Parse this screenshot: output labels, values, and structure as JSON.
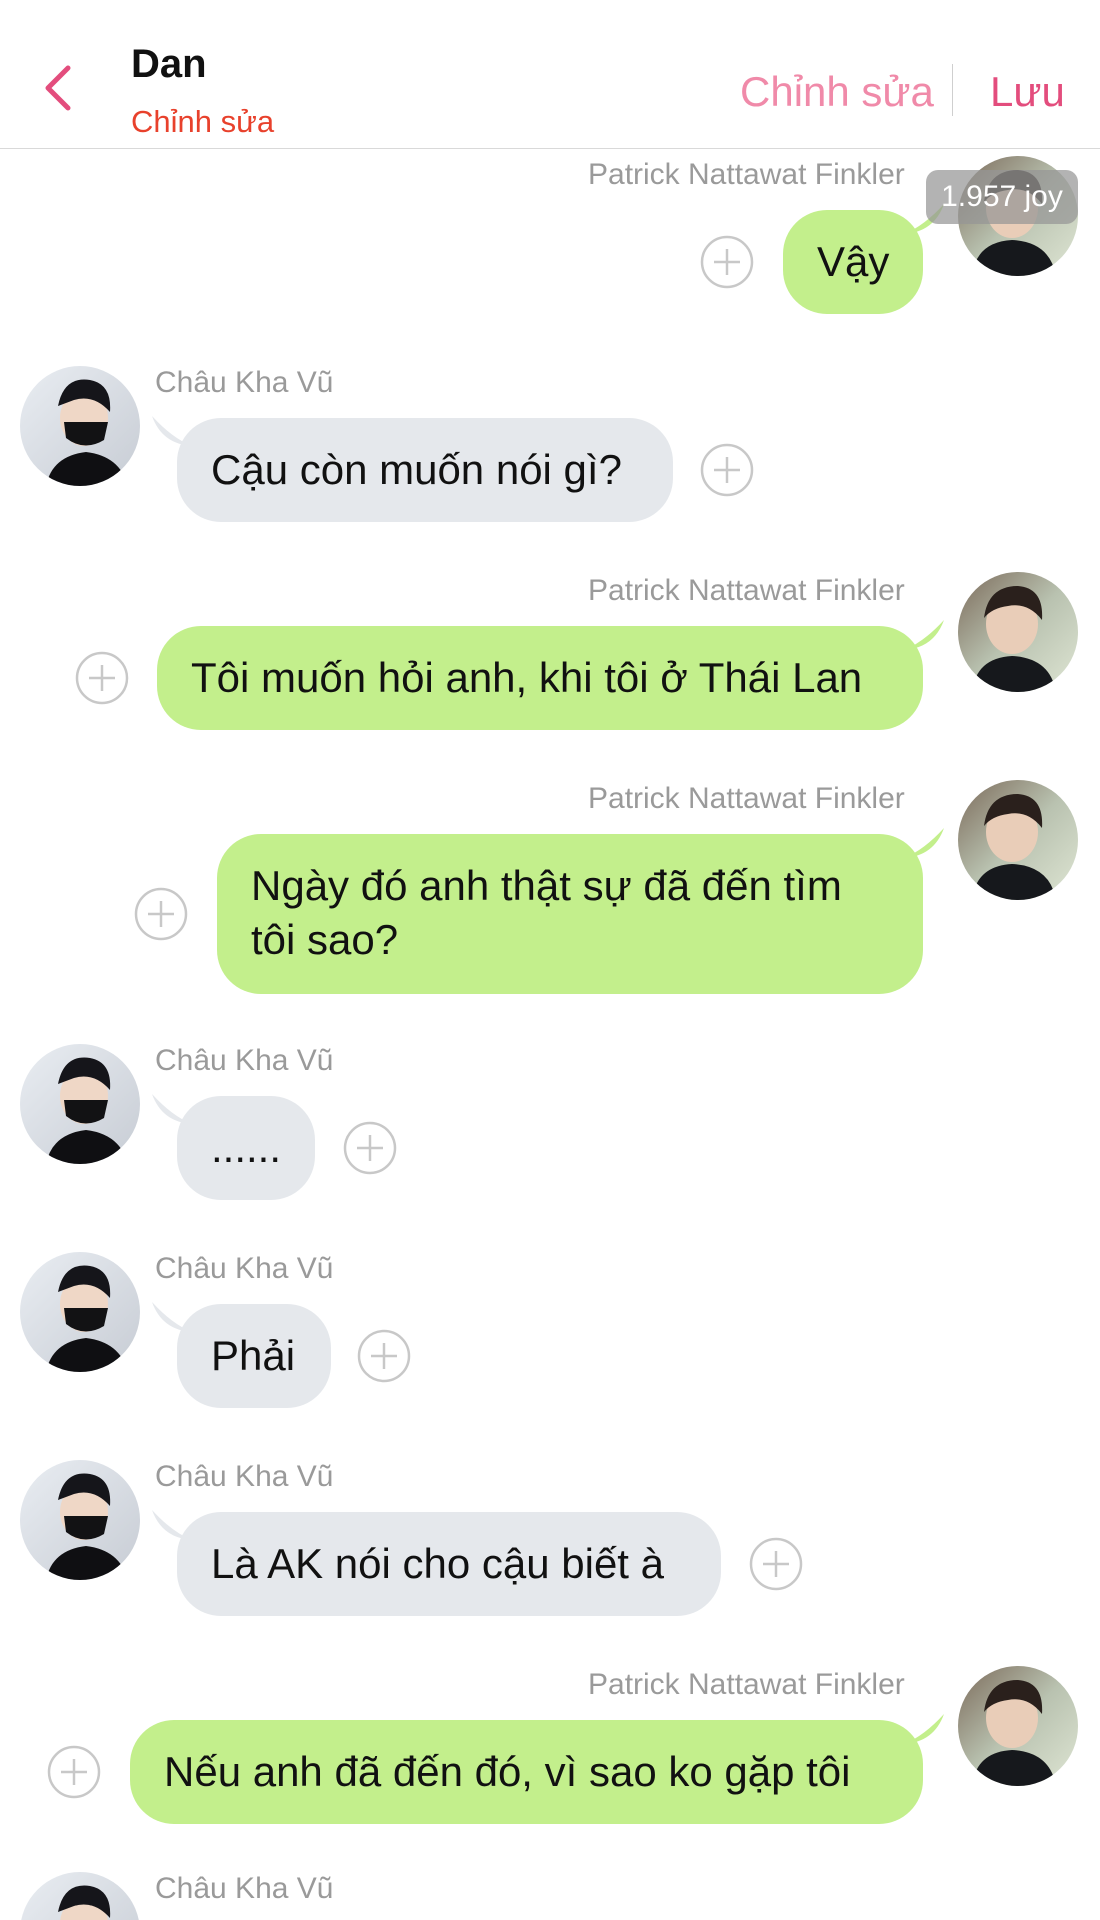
{
  "header": {
    "title": "Dan",
    "subtitle": "Chỉnh sửa",
    "edit_label": "Chỉnh sửa",
    "save_label": "Lưu"
  },
  "joy_badge": "1.957 joy",
  "messages": [
    {
      "side": "right",
      "sender": "Patrick Nattawat Finkler",
      "text": "Vậy"
    },
    {
      "side": "left",
      "sender": "Châu Kha Vũ",
      "text": "Cậu còn muốn nói gì?"
    },
    {
      "side": "right",
      "sender": "Patrick Nattawat Finkler",
      "text": "Tôi muốn hỏi anh, khi tôi ở Thái Lan"
    },
    {
      "side": "right",
      "sender": "Patrick Nattawat Finkler",
      "lines": [
        "Ngày đó anh thật sự đã đến tìm",
        "tôi sao?"
      ]
    },
    {
      "side": "left",
      "sender": "Châu Kha Vũ",
      "text": "......"
    },
    {
      "side": "left",
      "sender": "Châu Kha Vũ",
      "text": "Phải"
    },
    {
      "side": "left",
      "sender": "Châu Kha Vũ",
      "text": "Là AK nói cho cậu biết à"
    },
    {
      "side": "right",
      "sender": "Patrick Nattawat Finkler",
      "text": "Nếu anh đã đến đó, vì sao ko gặp tôi"
    },
    {
      "side": "left",
      "sender": "Châu Kha Vũ",
      "text": ""
    }
  ],
  "colors": {
    "accent_pink": "#e34d7d",
    "edit_pink": "#f08aa9",
    "subtitle_red": "#e8412c",
    "bubble_right": "#c3ef8c",
    "bubble_left": "#e5e8ec"
  }
}
